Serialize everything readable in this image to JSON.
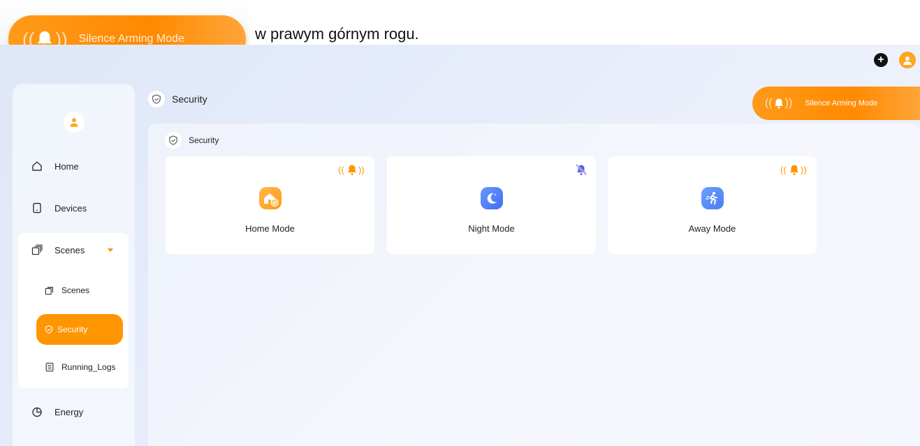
{
  "snippet": {
    "pill_label": "Silence Arming Mode",
    "caption": "w prawym górnym rogu."
  },
  "header": {
    "title": "Security",
    "silence_button": "Silence Arming Mode"
  },
  "sidebar": {
    "items": [
      {
        "label": "Home",
        "icon": "home-icon"
      },
      {
        "label": "Devices",
        "icon": "device-icon"
      },
      {
        "label": "Scenes",
        "icon": "scenes-icon",
        "expanded": true
      },
      {
        "label": "Energy",
        "icon": "energy-icon"
      }
    ],
    "sub_items": [
      {
        "label": "Scenes",
        "icon": "scenes-icon"
      },
      {
        "label": "Security",
        "icon": "shield-icon",
        "active": true
      },
      {
        "label": "Running_Logs",
        "icon": "log-icon"
      }
    ]
  },
  "panel": {
    "title": "Security",
    "cards": [
      {
        "label": "Home Mode",
        "icon": "home-shield-icon",
        "badge": "bell-ringing-icon"
      },
      {
        "label": "Night Mode",
        "icon": "moon-icon",
        "badge": "bell-muted-icon"
      },
      {
        "label": "Away Mode",
        "icon": "running-person-icon",
        "badge": "bell-ringing-icon"
      }
    ]
  },
  "colors": {
    "accent": "#ff9500",
    "night": "#4e7df5",
    "away": "#4a86f0",
    "home": "#ffa51f",
    "muted_bell": "#5a5fe0"
  }
}
